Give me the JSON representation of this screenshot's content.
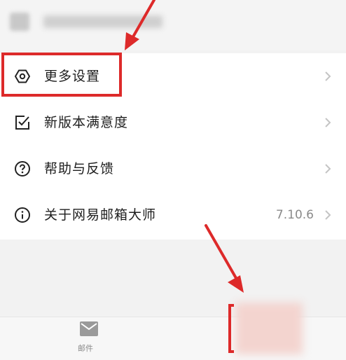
{
  "menu": {
    "items": [
      {
        "label": "更多设置",
        "icon": "gear-hexagon-icon"
      },
      {
        "label": "新版本满意度",
        "icon": "checkbox-icon"
      },
      {
        "label": "帮助与反馈",
        "icon": "question-circle-icon"
      },
      {
        "label": "关于网易邮箱大师",
        "icon": "info-circle-icon",
        "value": "7.10.6"
      }
    ]
  },
  "tabbar": {
    "mail_label": "邮件"
  },
  "colors": {
    "annotation_red": "#dd2a2a",
    "list_background": "#ffffff",
    "page_background": "#f2f2f2"
  }
}
